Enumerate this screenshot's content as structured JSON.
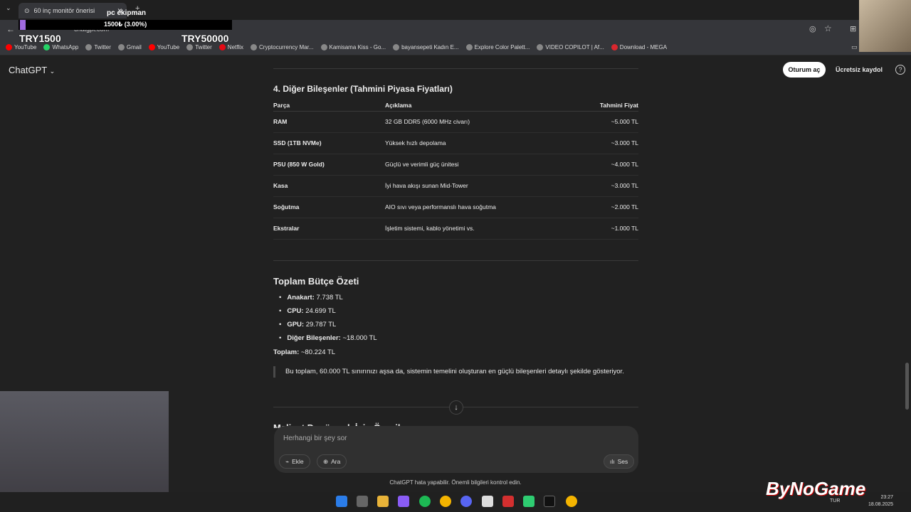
{
  "browser": {
    "tab_title": "60 inç monitör önerisi",
    "address": "chatgpt.com",
    "bookmarks": [
      {
        "label": "YouTube",
        "color": "#ff0000"
      },
      {
        "label": "WhatsApp",
        "color": "#25d366"
      },
      {
        "label": "Twitter",
        "color": "#888888"
      },
      {
        "label": "Gmail",
        "color": "#888888"
      },
      {
        "label": "YouTube",
        "color": "#ff0000"
      },
      {
        "label": "Twitter",
        "color": "#888888"
      },
      {
        "label": "Netflix",
        "color": "#e50914"
      },
      {
        "label": "Cryptocurrency Mar...",
        "color": "#888888"
      },
      {
        "label": "Kamisama Kiss - Go...",
        "color": "#888888"
      },
      {
        "label": "bayansepeti Kadın E...",
        "color": "#888888"
      },
      {
        "label": "Explore Color Palett...",
        "color": "#888888"
      },
      {
        "label": "VIDEO COPILOT | Af...",
        "color": "#888888"
      },
      {
        "label": "Download - MEGA",
        "color": "#d9272e"
      }
    ]
  },
  "donation": {
    "title": "pc ekipman",
    "progress_text": "1500₺ (3.00%)",
    "progress_fraction": 0.03,
    "min": "TRY1500",
    "max": "TRY50000"
  },
  "header": {
    "app_name": "ChatGPT",
    "login": "Oturum aç",
    "signup": "Ücretsiz kaydol",
    "help": "?"
  },
  "section": {
    "heading": "4. Diğer Bileşenler (Tahmini Piyasa Fiyatları)",
    "columns": [
      "Parça",
      "Açıklama",
      "Tahmini Fiyat"
    ],
    "rows": [
      [
        "RAM",
        "32 GB DDR5 (6000 MHz civarı)",
        "~5.000 TL"
      ],
      [
        "SSD (1TB NVMe)",
        "Yüksek hızlı depolama",
        "~3.000 TL"
      ],
      [
        "PSU (850 W Gold)",
        "Güçlü ve verimli güç ünitesi",
        "~4.000 TL"
      ],
      [
        "Kasa",
        "İyi hava akışı sunan Mid-Tower",
        "~3.000 TL"
      ],
      [
        "Soğutma",
        "AIO sıvı veya performanslı hava soğutma",
        "~2.000 TL"
      ],
      [
        "Ekstralar",
        "İşletim sistemi, kablo yönetimi vs.",
        "~1.000 TL"
      ]
    ]
  },
  "budget": {
    "title": "Toplam Bütçe Özeti",
    "items": [
      {
        "label": "Anakart:",
        "value": " 7.738 TL"
      },
      {
        "label": "CPU:",
        "value": " 24.699 TL"
      },
      {
        "label": "GPU:",
        "value": " 29.787 TL"
      },
      {
        "label": "Diğer Bileşenler:",
        "value": " ~18.000 TL"
      }
    ],
    "total_label": "Toplam:",
    "total_value": " ~80.224 TL",
    "note": "Bu toplam, 60.000 TL sınırınızı aşsa da, sistemin temelini oluşturan en güçlü bileşenleri detaylı şekilde gösteriyor.",
    "next_heading": "Maliyet Duşürmek İçin Öneriler"
  },
  "composer": {
    "placeholder": "Herhangi bir şey sor",
    "attach": "Ekle",
    "search": "Ara",
    "voice": "Ses"
  },
  "disclaimer": "ChatGPT hata yapabilir. Önemli bilgileri kontrol edin.",
  "overlay": {
    "logo": "ByNoGame"
  },
  "taskbar": {
    "lang": "TUR",
    "time": "23:27",
    "date": "18.08.2025"
  }
}
